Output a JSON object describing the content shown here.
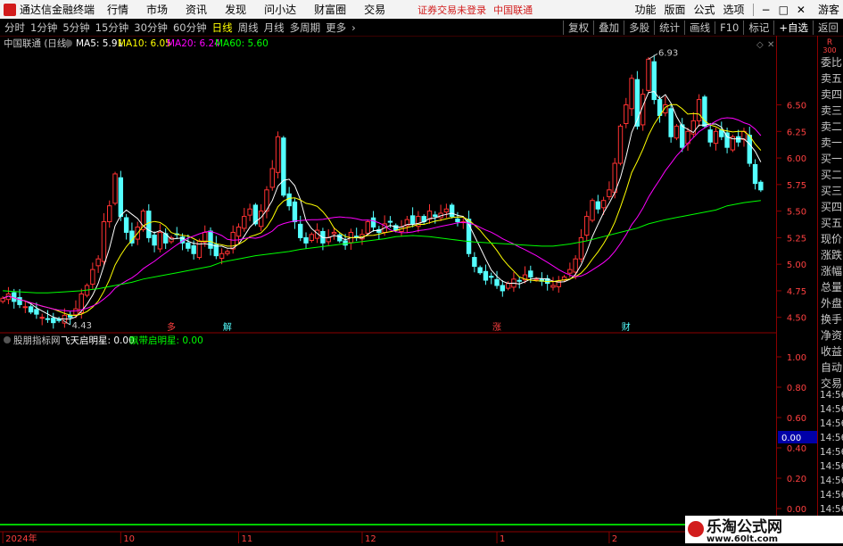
{
  "titlebar": {
    "app_name": "通达信金融终端",
    "menus": [
      "行情",
      "市场",
      "资讯",
      "发现",
      "问小达",
      "财富圈",
      "交易"
    ],
    "status": "证券交易未登录",
    "stock": "中国联通",
    "right_menus": [
      "功能",
      "版面",
      "公式",
      "选项"
    ],
    "user": "游客",
    "window_buttons": [
      "−",
      "□",
      "✕"
    ]
  },
  "toolbar": {
    "timeframes": [
      "分时",
      "1分钟",
      "5分钟",
      "15分钟",
      "30分钟",
      "60分钟",
      "日线",
      "周线",
      "月线",
      "多周期",
      "更多"
    ],
    "active_timeframe": "日线",
    "right_buttons": [
      "复权",
      "叠加",
      "多股",
      "统计",
      "画线",
      "F10",
      "标记",
      "+自选",
      "返回"
    ]
  },
  "legend": {
    "title": "中国联通 (日线)",
    "ma": [
      {
        "label": "MA5: 5.91",
        "color": "#ffffff"
      },
      {
        "label": "MA10: 6.05",
        "color": "#ffff00"
      },
      {
        "label": "MA20: 6.24",
        "color": "#ff00ff"
      },
      {
        "label": "MA60: 5.60",
        "color": "#00ff00"
      }
    ]
  },
  "indicator": {
    "name": "股朋指标网",
    "fields": [
      {
        "label": "飞天启明星: 0.00",
        "color": "#ffffff"
      },
      {
        "label": "飘带启明星: 0.00",
        "color": "#00ff00"
      }
    ],
    "axis": [
      "1.00",
      "0.80",
      "0.60",
      "0.40",
      "0.20",
      "0.00"
    ],
    "current_value": "0.00"
  },
  "markers": {
    "high": "6.93",
    "low": "4.43",
    "events": [
      "多",
      "解",
      "涨",
      "财"
    ]
  },
  "date_axis": [
    {
      "label": "2024年",
      "index": 0
    },
    {
      "label": "10",
      "index": 21
    },
    {
      "label": "11",
      "index": 42
    },
    {
      "label": "12",
      "index": 64
    },
    {
      "label": "1",
      "index": 88
    },
    {
      "label": "2",
      "index": 108
    },
    {
      "label": "3",
      "index": 128
    }
  ],
  "right_panel": {
    "rank": "R",
    "code": "300",
    "labels": [
      "委比",
      "卖五",
      "卖四",
      "卖三",
      "卖二",
      "卖一",
      "买一",
      "买二",
      "买三",
      "买四",
      "买五",
      "现价",
      "涨跌",
      "涨幅",
      "总量",
      "外盘",
      "换手",
      "净资",
      "收益",
      "自动",
      "交易"
    ],
    "times": [
      "14:56",
      "14:56",
      "14:56",
      "14:56",
      "14:56",
      "14:56",
      "14:56",
      "14:56",
      "14:56",
      "14:56",
      "14:56"
    ]
  },
  "watermark": {
    "title": "乐淘公式网",
    "url": "www.60lt.com"
  },
  "chart_data": {
    "type": "candlestick",
    "y_ticks": [
      4.5,
      4.75,
      5.0,
      5.25,
      5.5,
      5.75,
      6.0,
      6.25,
      6.5
    ],
    "ylim": [
      4.38,
      7.0
    ],
    "colors": {
      "up": "#ff3232",
      "down": "#54ffff"
    },
    "closes": [
      4.68,
      4.72,
      4.65,
      4.62,
      4.6,
      4.55,
      4.53,
      4.5,
      4.48,
      4.45,
      4.47,
      4.52,
      4.5,
      4.58,
      4.72,
      4.8,
      4.95,
      5.05,
      5.4,
      5.55,
      5.85,
      5.45,
      5.3,
      5.2,
      5.35,
      5.5,
      5.25,
      5.18,
      5.3,
      5.2,
      5.25,
      5.28,
      5.2,
      5.15,
      5.1,
      5.22,
      5.3,
      5.15,
      5.08,
      5.1,
      5.12,
      5.3,
      5.35,
      5.45,
      5.52,
      5.38,
      5.5,
      5.7,
      5.9,
      6.2,
      5.65,
      5.55,
      5.4,
      5.25,
      5.2,
      5.28,
      5.32,
      5.2,
      5.25,
      5.3,
      5.22,
      5.18,
      5.3,
      5.25,
      5.28,
      5.4,
      5.35,
      5.3,
      5.38,
      5.4,
      5.32,
      5.35,
      5.42,
      5.38,
      5.45,
      5.4,
      5.5,
      5.45,
      5.48,
      5.52,
      5.45,
      5.4,
      5.4,
      5.1,
      4.98,
      4.92,
      4.85,
      4.88,
      4.8,
      4.75,
      4.82,
      4.86,
      4.84,
      4.9,
      4.88,
      4.86,
      4.84,
      4.82,
      4.8,
      4.84,
      4.88,
      4.95,
      5.05,
      5.25,
      5.45,
      5.6,
      5.52,
      5.6,
      5.7,
      5.95,
      6.3,
      6.5,
      6.75,
      6.3,
      6.6,
      6.93,
      6.55,
      6.4,
      6.5,
      6.2,
      6.3,
      6.1,
      6.25,
      6.35,
      6.55,
      6.3,
      6.15,
      6.25,
      6.2,
      6.1,
      6.2,
      6.15,
      6.25,
      5.95,
      5.76,
      5.7
    ],
    "ma60": [
      4.75,
      4.74,
      4.73,
      4.73,
      4.74,
      4.75,
      4.77,
      4.8,
      4.83,
      4.86,
      4.89,
      4.92,
      4.95,
      4.98,
      5.02,
      5.05,
      5.08,
      5.1,
      5.12,
      5.14,
      5.16,
      5.18,
      5.2,
      5.22,
      5.24,
      5.26,
      5.27,
      5.26,
      5.24,
      5.22,
      5.21,
      5.2,
      5.19,
      5.18,
      5.17,
      5.17,
      5.19,
      5.22,
      5.26,
      5.3,
      5.34,
      5.38,
      5.42,
      5.45,
      5.48,
      5.51,
      5.55,
      5.58,
      5.6
    ],
    "annotations": {
      "high": "6.93",
      "low": "4.43"
    }
  }
}
